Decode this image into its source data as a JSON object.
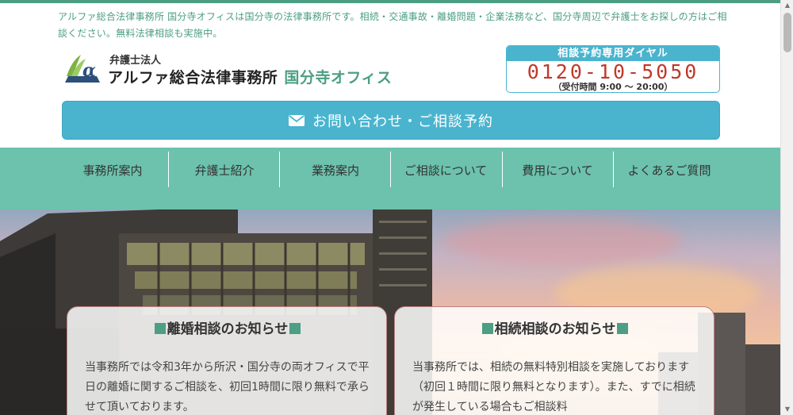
{
  "header": {
    "intro": "アルファ総合法律事務所 国分寺オフィスは国分寺の法律事務所です。相続・交通事故・離婚問題・企業法務など、国分寺周辺で弁護士をお探しの方はご相談ください。無料法律相談も実施中。",
    "logo_sub": "弁護士法人",
    "logo_main": "アルファ総合法律事務所",
    "logo_office": "国分寺オフィス"
  },
  "phone": {
    "title": "相談予約専用ダイヤル",
    "number": "0120-10-5050",
    "hours": "（受付時間 9:00 ～ 20:00）"
  },
  "contact_button": {
    "label": "お問い合わせ・ご相談予約"
  },
  "nav": {
    "items": [
      {
        "label": "事務所案内"
      },
      {
        "label": "弁護士紹介"
      },
      {
        "label": "業務案内"
      },
      {
        "label": "ご相談について"
      },
      {
        "label": "費用について"
      },
      {
        "label": "よくあるご質問"
      }
    ]
  },
  "notices": [
    {
      "title": "離婚相談のお知らせ",
      "body": "当事務所では令和3年から所沢・国分寺の両オフィスで平日の離婚に関するご相談を、初回1時間に限り無料で承らせて頂いております。"
    },
    {
      "title": "相続相談のお知らせ",
      "body": "当事務所では、相続の無料特別相談を実施しております（初回１時間に限り無料となります）。また、すでに相続が発生している場合もご相談料"
    }
  ],
  "colors": {
    "brand_green": "#4c9e85",
    "nav_green": "#6cc2ad",
    "accent_blue": "#4ab4cf",
    "phone_red": "#c0392b"
  },
  "icons": {
    "mail": "mail-icon",
    "logo": "logo-mark-icon"
  }
}
